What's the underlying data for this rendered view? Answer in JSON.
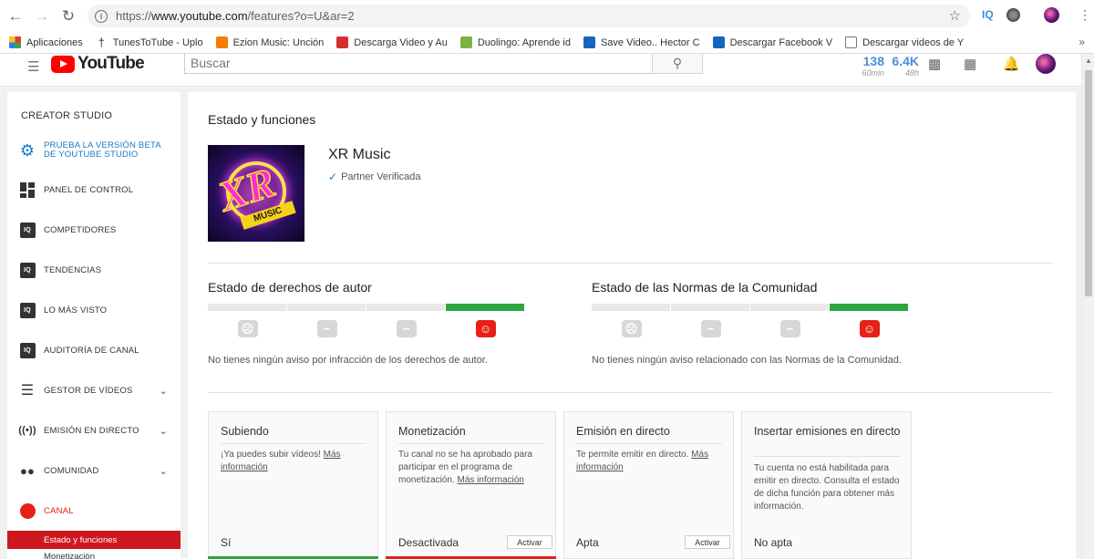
{
  "browser": {
    "url_prefix": "https://",
    "url_host": "www.youtube.com",
    "url_path": "/features?o=U&ar=2",
    "ext_iq": "IQ",
    "bookmarks": [
      {
        "label": "Aplicaciones",
        "icon": "apps-icon"
      },
      {
        "label": "TunesToTube - Uplo",
        "icon": "tunestotube-icon"
      },
      {
        "label": "Ezion Music: Unción",
        "icon": "ezion-icon"
      },
      {
        "label": "Descarga Video y Au",
        "icon": "download-icon"
      },
      {
        "label": "Duolingo: Aprende id",
        "icon": "duolingo-icon"
      },
      {
        "label": "Save Video.. Hector C",
        "icon": "savevideo-icon"
      },
      {
        "label": "Descargar Facebook V",
        "icon": "facebook-dl-icon"
      },
      {
        "label": "Descargar videos de Y",
        "icon": "document-icon"
      }
    ]
  },
  "header": {
    "logo_text": "YouTube",
    "search_placeholder": "Buscar",
    "stat1_value": "138",
    "stat1_label": "60min",
    "stat2_value": "6.4K",
    "stat2_label": "48h"
  },
  "sidebar": {
    "title": "CREATOR STUDIO",
    "beta_line1": "PRUEBA LA VERSIÓN BETA",
    "beta_line2": "DE YOUTUBE STUDIO",
    "items": [
      {
        "label": "PANEL DE CONTROL"
      },
      {
        "label": "COMPETIDORES"
      },
      {
        "label": "TENDENCIAS"
      },
      {
        "label": "LO MÁS VISTO"
      },
      {
        "label": "AUDITORÍA DE CANAL"
      },
      {
        "label": "GESTOR DE VÍDEOS"
      },
      {
        "label": "EMISIÓN EN DIRECTO"
      },
      {
        "label": "COMUNIDAD"
      },
      {
        "label": "CANAL"
      }
    ],
    "active_sub": "Estado y funciones",
    "next_sub": "Monetización"
  },
  "main": {
    "title": "Estado y funciones",
    "channel_name": "XR Music",
    "partner_status": "Partner Verificada",
    "thumb_text_main": "XR",
    "thumb_text_sub": "MUSIC",
    "copyright_title": "Estado de derechos de autor",
    "copyright_note": "No tienes ningún aviso por infracción de los derechos de autor.",
    "community_title": "Estado de las Normas de la Comunidad",
    "community_note": "No tienes ningún aviso relacionado con las Normas de la Comunidad.",
    "cards": [
      {
        "title": "Subiendo",
        "body": "¡Ya puedes subir vídeos! ",
        "more": "Más información",
        "status": "Sí",
        "strip_color": "#2ba640"
      },
      {
        "title": "Monetización",
        "body": "Tu canal no se ha aprobado para participar en el programa de monetización. ",
        "more": "Más información",
        "status": "Desactivada",
        "button": "Activar",
        "strip_color": "#e62117"
      },
      {
        "title": "Emisión en directo",
        "body": "Te permite emitir en directo. ",
        "more": "Más información",
        "status": "Apta",
        "button": "Activar"
      },
      {
        "title": "Insertar emisiones en directo",
        "body": "Tu cuenta no está habilitada para emitir en directo. Consulta el estado de dicha función para obtener más información.",
        "status": "No apta"
      }
    ]
  },
  "colors": {
    "yt_red": "#ff0000",
    "good_green": "#2ba640",
    "alert_red": "#e62117",
    "link_blue": "#167ac6"
  }
}
